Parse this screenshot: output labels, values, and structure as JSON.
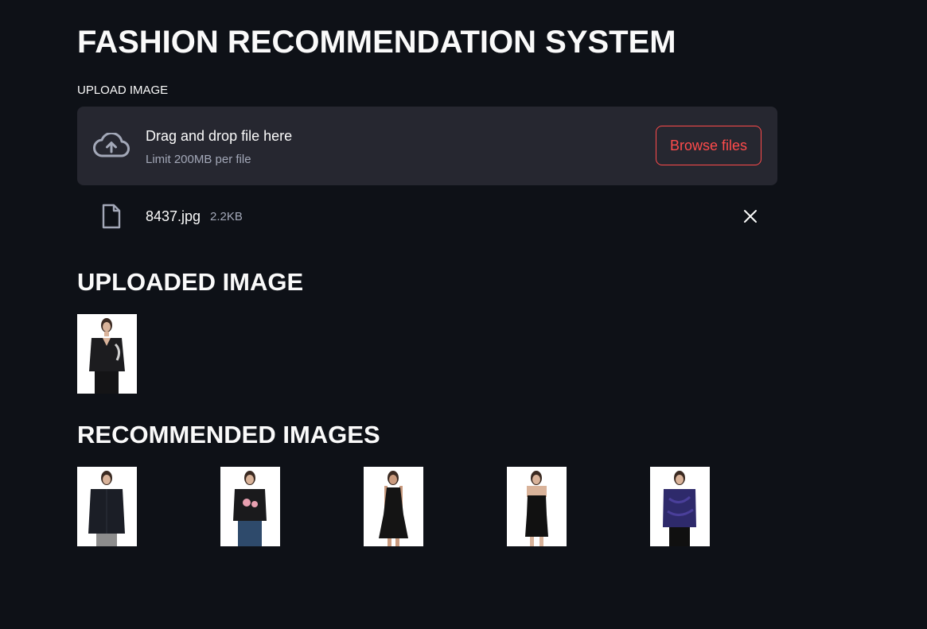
{
  "app": {
    "title": "FASHION RECOMMENDATION SYSTEM"
  },
  "uploader": {
    "label": "UPLOAD IMAGE",
    "drop_text": "Drag and drop file here",
    "limit_text": "Limit 200MB per file",
    "browse_label": "Browse files",
    "icon": "cloud-upload-icon",
    "accent_color": "#ff4b4b"
  },
  "uploaded_file": {
    "name": "8437.jpg",
    "size": "2.2KB",
    "icon": "file-icon",
    "remove_icon": "close-icon"
  },
  "sections": {
    "uploaded_heading": "UPLOADED IMAGE",
    "recommended_heading": "RECOMMENDED IMAGES"
  },
  "uploaded_image": {
    "garment": "black v-neck t-shirt with print",
    "top_color": "#1c1c1f",
    "bottom_color": "#141416"
  },
  "recommended_images": [
    {
      "garment": "black long shirt",
      "top_color": "#1b1e26",
      "bottom_color": "#8c8c8c"
    },
    {
      "garment": "black printed t-shirt",
      "top_color": "#1a1a1c",
      "bottom_color": "#2e4a6b"
    },
    {
      "garment": "black sleeveless dress",
      "top_color": "#141414",
      "bottom_color": "#141414"
    },
    {
      "garment": "black strappy dress",
      "top_color": "#111111",
      "bottom_color": "#111111"
    },
    {
      "garment": "purple top",
      "top_color": "#2e2a6b",
      "bottom_color": "#101010"
    }
  ],
  "colors": {
    "background": "#0e1117",
    "dropzone_background": "#262730",
    "text": "#fafafa",
    "muted_text": "#a3a8b8"
  }
}
